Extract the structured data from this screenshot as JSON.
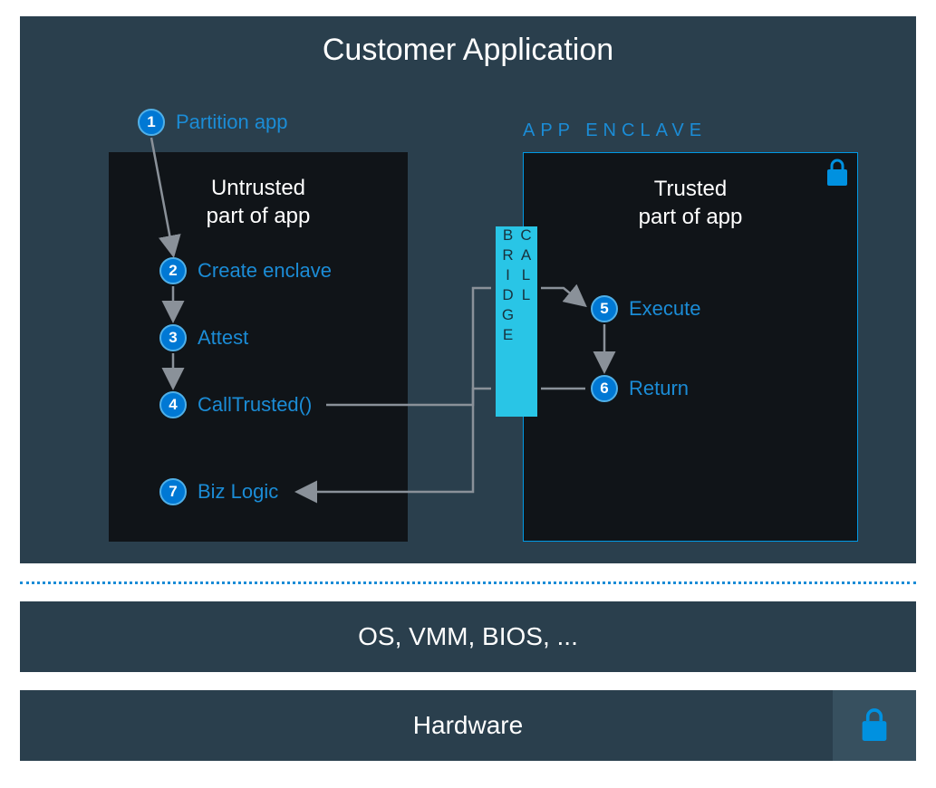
{
  "title": "Customer Application",
  "untrusted": {
    "heading_line1": "Untrusted",
    "heading_line2": "part of app"
  },
  "trusted": {
    "heading_line1": "Trusted",
    "heading_line2": "part of app",
    "enclave_label": "APP ENCLAVE"
  },
  "steps": {
    "s1": {
      "num": "1",
      "label": "Partition app"
    },
    "s2": {
      "num": "2",
      "label": "Create enclave"
    },
    "s3": {
      "num": "3",
      "label": "Attest"
    },
    "s4": {
      "num": "4",
      "label": "CallTrusted()"
    },
    "s5": {
      "num": "5",
      "label": "Execute"
    },
    "s6": {
      "num": "6",
      "label": "Return"
    },
    "s7": {
      "num": "7",
      "label": "Biz Logic"
    }
  },
  "call_bridge": "CALL BRIDGE",
  "os_layer": "OS, VMM, BIOS, ...",
  "hardware_layer": "Hardware"
}
